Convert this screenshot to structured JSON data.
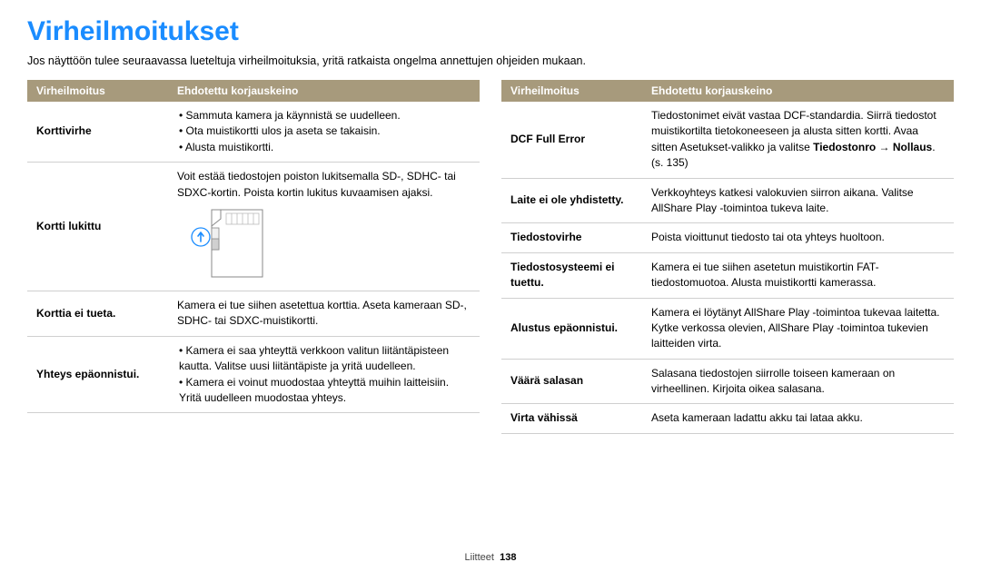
{
  "title": "Virheilmoitukset",
  "intro": "Jos näyttöön tulee seuraavassa lueteltuja virheilmoituksia, yritä ratkaista ongelma annettujen ohjeiden mukaan.",
  "headers": {
    "col1": "Virheilmoitus",
    "col2": "Ehdotettu korjauskeino"
  },
  "left": {
    "korttivirhe": {
      "label": "Korttivirhe",
      "b1": "Sammuta kamera ja käynnistä se uudelleen.",
      "b2": "Ota muistikortti ulos ja aseta se takaisin.",
      "b3": "Alusta muistikortti."
    },
    "kortti_lukittu": {
      "label": "Kortti lukittu",
      "text": "Voit estää tiedostojen poiston lukitsemalla SD-, SDHC- tai SDXC-kortin. Poista kortin lukitus kuvaamisen ajaksi."
    },
    "korttia_ei_tueta": {
      "label": "Korttia ei tueta.",
      "text": "Kamera ei tue siihen asetettua korttia. Aseta kameraan SD-, SDHC- tai SDXC-muistikortti."
    },
    "yhteys_epaonnistui": {
      "label": "Yhteys epäonnistui.",
      "b1": "Kamera ei saa yhteyttä verkkoon valitun liitäntäpisteen kautta. Valitse uusi liitäntäpiste ja yritä uudelleen.",
      "b2": "Kamera ei voinut muodostaa yhteyttä muihin laitteisiin. Yritä uudelleen muodostaa yhteys."
    }
  },
  "right": {
    "dcf": {
      "label": "DCF Full Error",
      "text1": "Tiedostonimet eivät vastaa DCF-standardia. Siirrä tiedostot muistikortilta tietokoneeseen ja alusta sitten kortti. Avaa sitten Asetukset-valikko ja valitse ",
      "bolda": "Tiedostonro",
      "arrow": " → ",
      "boldb": "Nollaus",
      "tail": ". (s. 135)"
    },
    "laite": {
      "label": "Laite ei ole yhdistetty.",
      "text": "Verkkoyhteys katkesi valokuvien siirron aikana. Valitse AllShare Play -toimintoa tukeva laite."
    },
    "tiedostovirhe": {
      "label": "Tiedostovirhe",
      "text": "Poista vioittunut tiedosto tai ota yhteys huoltoon."
    },
    "fs": {
      "label": "Tiedostosysteemi ei tuettu.",
      "text": "Kamera ei tue siihen asetetun muistikortin FAT-tiedostomuotoa. Alusta muistikortti kamerassa."
    },
    "alustus": {
      "label": "Alustus epäonnistui.",
      "text": "Kamera ei löytänyt AllShare Play -toimintoa tukevaa laitetta. Kytke verkossa olevien, AllShare Play -toimintoa tukevien laitteiden virta."
    },
    "salasana": {
      "label": "Väärä salasan",
      "text": "Salasana tiedostojen siirrolle toiseen kameraan on virheellinen. Kirjoita oikea salasana."
    },
    "virta": {
      "label": "Virta vähissä",
      "text": "Aseta kameraan ladattu akku tai lataa akku."
    }
  },
  "footer": {
    "section": "Liitteet",
    "page": "138"
  }
}
